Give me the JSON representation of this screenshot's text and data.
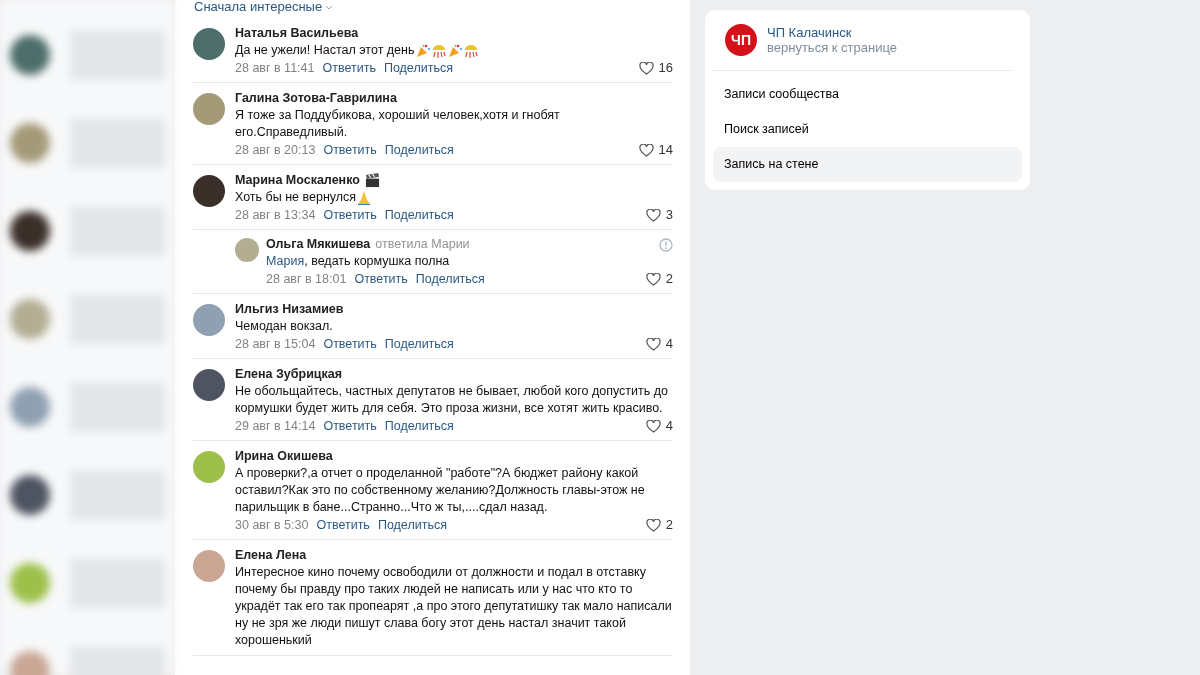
{
  "sort_label": "Сначала интересные",
  "comments": [
    {
      "kind": "comment",
      "author": "Наталья Васильева",
      "text": "Да не ужели! Настал этот день",
      "emoji": [
        {
          "kind": "party"
        },
        {
          "kind": "confetti"
        },
        {
          "kind": "party"
        },
        {
          "kind": "confetti"
        }
      ],
      "date": "28 авг в 11:41",
      "reply": "Ответить",
      "share": "Поделиться",
      "likes": "16"
    },
    {
      "kind": "comment",
      "author": "Галина Зотова-Гаврилина",
      "text": "Я тоже за Поддубикова, хороший человек,хотя и гнобят его.Справедливый.",
      "date": "28 авг в 20:13",
      "reply": "Ответить",
      "share": "Поделиться",
      "likes": "14"
    },
    {
      "kind": "comment",
      "author": "Марина Москаленко",
      "author_emoji": {
        "kind": "clapper"
      },
      "text": "Хоть бы не вернулся",
      "emoji": [
        {
          "kind": "pray"
        }
      ],
      "date": "28 авг в 13:34",
      "reply": "Ответить",
      "share": "Поделиться",
      "likes": "3"
    },
    {
      "kind": "reply",
      "author": "Ольга Мякишева",
      "replied_to": "ответила Марии",
      "mention": "Мария",
      "text": ", ведать кормушка полна",
      "date": "28 авг в 18:01",
      "reply": "Ответить",
      "share": "Поделиться",
      "likes": "2"
    },
    {
      "kind": "comment",
      "author": "Ильгиз Низамиев",
      "text": "Чемодан вокзал.",
      "date": "28 авг в 15:04",
      "reply": "Ответить",
      "share": "Поделиться",
      "likes": "4"
    },
    {
      "kind": "comment",
      "author": "Елена Зубрицкая",
      "text": "Не обольщайтесь, частных депутатов не бывает, любой кого допустить до кормушки будет жить для себя. Это проза жизни, все хотят жить красиво.",
      "date": "29 авг в 14:14",
      "reply": "Ответить",
      "share": "Поделиться",
      "likes": "4"
    },
    {
      "kind": "comment",
      "author": "Ирина Окишева",
      "text": "А проверки?,а отчет о проделанной \"работе\"?А бюджет району какой оставил?Как это по собственному желанию?Должность главы-этож не парильщик в бане...Странно...Что ж ты,....сдал назад.",
      "date": "30 авг в 5:30",
      "reply": "Ответить",
      "share": "Поделиться",
      "likes": "2"
    },
    {
      "kind": "comment",
      "author": "Елена Лена",
      "text": "Интересное кино почему освободили от должности и подал в отставку почему бы правду про таких людей не написать или у нас что кто то украдёт так его так пропеарят ,а про этого депутатишку так мало написали ну не зря же люди пишут слава богу этот день настал значит такой хорошенький"
    }
  ],
  "sidebar": {
    "group_name": "ЧП Калачинск",
    "group_logo": "ЧП",
    "back_link": "вернуться к странице",
    "items": [
      {
        "label": "Записи сообщества",
        "selected": false
      },
      {
        "label": "Поиск записей",
        "selected": false
      },
      {
        "label": "Запись на стене",
        "selected": true
      }
    ]
  }
}
